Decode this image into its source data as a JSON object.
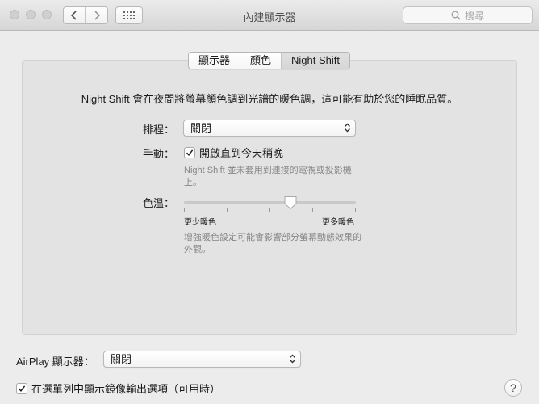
{
  "window": {
    "title": "內建顯示器",
    "search_placeholder": "搜尋"
  },
  "tabs": [
    {
      "label": "顯示器",
      "selected": false
    },
    {
      "label": "顏色",
      "selected": false
    },
    {
      "label": "Night Shift",
      "selected": true
    }
  ],
  "night_shift": {
    "description": "Night Shift 會在夜間將螢幕顏色調到光譜的暖色調，這可能有助於您的睡眠品質。",
    "schedule_label": "排程：",
    "schedule_value": "關閉",
    "manual_label": "手動：",
    "manual_checkbox_label": "開啟直到今天稍晚",
    "manual_checked": true,
    "manual_note": "Night Shift 並未套用到連接的電視或投影機上。",
    "temperature_label": "色溫：",
    "temperature_level": 0.62,
    "slider_min_label": "更少暖色",
    "slider_max_label": "更多暖色",
    "temperature_note": "增強暖色設定可能會影響部分螢幕動態效果的外觀。"
  },
  "footer": {
    "airplay_label": "AirPlay 顯示器：",
    "airplay_value": "關閉",
    "mirror_checkbox_label": "在選單列中顯示鏡像輸出選項（可用時）",
    "mirror_checked": true,
    "help_label": "?"
  },
  "icons": {
    "back": "chevron-left-icon",
    "forward": "chevron-right-icon",
    "grid": "grid-icon",
    "search": "search-icon",
    "popup_arrows": "up-down-arrows-icon",
    "checkmark": "checkmark-icon"
  }
}
